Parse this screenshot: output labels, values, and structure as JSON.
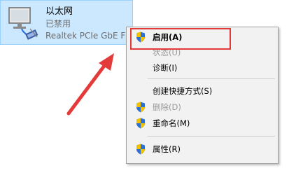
{
  "adapter": {
    "name": "以太网",
    "status": "已禁用",
    "device": "Realtek PCIe GbE F"
  },
  "menu": {
    "enable_label": "启用(A)",
    "status_label": "状态(U)",
    "diagnose_label": "诊断(I)",
    "shortcut_label": "创建快捷方式(S)",
    "delete_label": "删除(D)",
    "rename_label": "重命名(M)",
    "properties_label": "属性(R)"
  },
  "colors": {
    "annotation_red": "#e33a3a",
    "selection_blue": "#cce8ff",
    "menu_background": "#f2f2f2"
  },
  "icons": {
    "adapter": "network-adapter-icon",
    "admin": "uac-shield-icon"
  }
}
